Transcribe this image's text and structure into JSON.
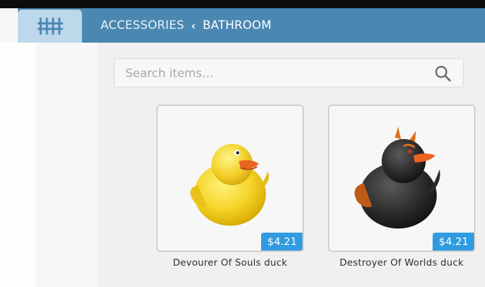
{
  "header": {
    "tab_icon": "fence-grid-icon",
    "breadcrumb": {
      "parent": "ACCESSORIES",
      "separator_icon": "chevron-left-icon",
      "current": "BATHROOM"
    }
  },
  "search": {
    "placeholder": "Search items…",
    "icon": "search-icon"
  },
  "items": [
    {
      "name": "Devourer Of Souls duck",
      "price": "$4.21",
      "icon": "yellow-rubber-duck"
    },
    {
      "name": "Destroyer Of Worlds duck",
      "price": "$4.21",
      "icon": "black-devil-rubber-duck"
    }
  ],
  "colors": {
    "header_bg": "#4a88b2",
    "tab_active_bg": "#bcd8ea",
    "price_badge_bg": "#2f9be0"
  }
}
